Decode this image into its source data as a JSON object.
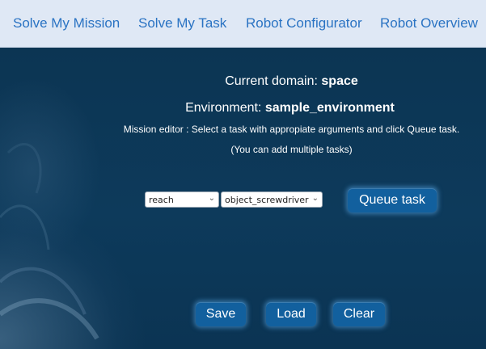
{
  "nav": {
    "items": [
      {
        "label": "Solve My Mission"
      },
      {
        "label": "Solve My Task"
      },
      {
        "label": "Robot Configurator"
      },
      {
        "label": "Robot Overview"
      }
    ]
  },
  "main": {
    "domain_prefix": "Current domain: ",
    "domain_value": "space",
    "environment_prefix": "Environment: ",
    "environment_value": "sample_environment",
    "editor_instruction": "Mission editor : Select a task with appropiate arguments and click Queue task.",
    "editor_hint": "(You can add multiple tasks)",
    "task_select": {
      "selected": "reach"
    },
    "argument_select": {
      "selected": "object_screwdriver"
    },
    "queue_label": "Queue task",
    "save_label": "Save",
    "load_label": "Load",
    "clear_label": "Clear"
  },
  "colors": {
    "nav_background": "#dfe8f5",
    "nav_link": "#2a73c3",
    "page_background": "#0c3553",
    "button": "#12609e",
    "button_glow": "#5aaaeb"
  }
}
